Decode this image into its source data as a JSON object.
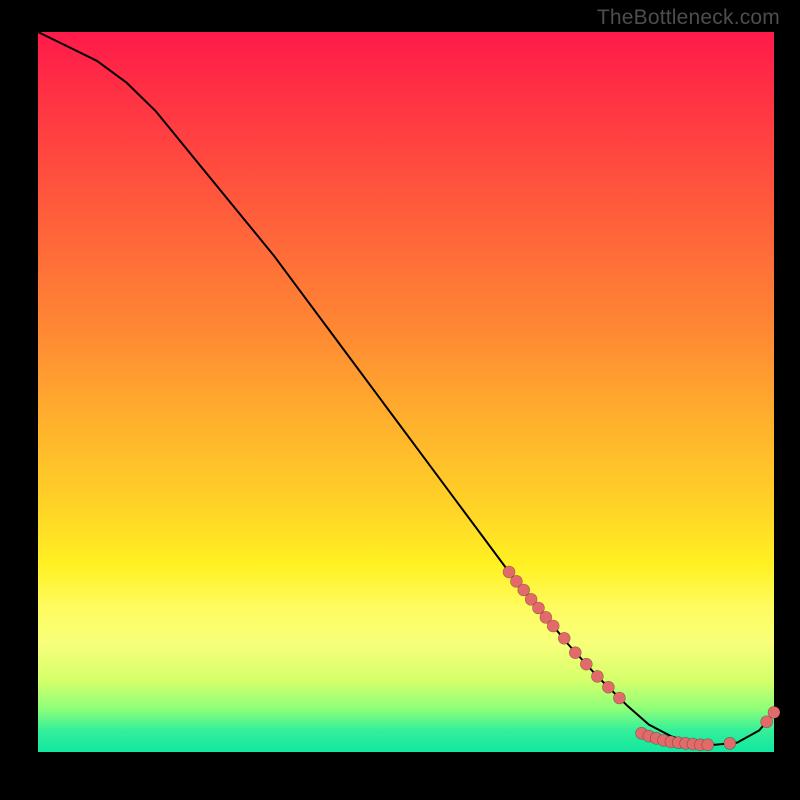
{
  "watermark": "TheBottleneck.com",
  "chart_data": {
    "type": "line",
    "title": "",
    "xlabel": "",
    "ylabel": "",
    "xlim": [
      0,
      100
    ],
    "ylim": [
      0,
      100
    ],
    "background_gradient": {
      "orientation": "vertical",
      "stops": [
        {
          "pos": 0,
          "color": "#ff1a4b"
        },
        {
          "pos": 0.5,
          "color": "#ffb02d"
        },
        {
          "pos": 0.8,
          "color": "#fffc60"
        },
        {
          "pos": 1.0,
          "color": "#11e8a0"
        }
      ]
    },
    "series": [
      {
        "name": "curve",
        "x": [
          0,
          4,
          8,
          12,
          16,
          20,
          24,
          28,
          32,
          36,
          40,
          44,
          48,
          52,
          56,
          60,
          64,
          68,
          72,
          76,
          80,
          83,
          86,
          89,
          92,
          95,
          98,
          100
        ],
        "y": [
          100,
          98,
          96,
          93,
          89,
          84,
          79,
          74,
          69,
          63.5,
          58,
          52.5,
          47,
          41.5,
          36,
          30.5,
          25,
          20,
          15,
          10.5,
          6.5,
          3.8,
          2.2,
          1.2,
          1.0,
          1.3,
          3.0,
          5.5
        ]
      }
    ],
    "markers": [
      {
        "x": 64,
        "y": 25.0
      },
      {
        "x": 65,
        "y": 23.7
      },
      {
        "x": 66,
        "y": 22.5
      },
      {
        "x": 67,
        "y": 21.2
      },
      {
        "x": 68,
        "y": 20.0
      },
      {
        "x": 69,
        "y": 18.7
      },
      {
        "x": 70,
        "y": 17.5
      },
      {
        "x": 71.5,
        "y": 15.8
      },
      {
        "x": 73,
        "y": 13.8
      },
      {
        "x": 74.5,
        "y": 12.2
      },
      {
        "x": 76,
        "y": 10.5
      },
      {
        "x": 77.5,
        "y": 9.0
      },
      {
        "x": 79,
        "y": 7.5
      },
      {
        "x": 82,
        "y": 2.6
      },
      {
        "x": 83,
        "y": 2.2
      },
      {
        "x": 84,
        "y": 1.9
      },
      {
        "x": 85,
        "y": 1.6
      },
      {
        "x": 86,
        "y": 1.4
      },
      {
        "x": 87,
        "y": 1.3
      },
      {
        "x": 88,
        "y": 1.2
      },
      {
        "x": 89,
        "y": 1.1
      },
      {
        "x": 90,
        "y": 1.0
      },
      {
        "x": 91,
        "y": 1.0
      },
      {
        "x": 94,
        "y": 1.2
      },
      {
        "x": 99,
        "y": 4.2
      },
      {
        "x": 100,
        "y": 5.5
      }
    ],
    "marker_color": "#e36a6a"
  }
}
